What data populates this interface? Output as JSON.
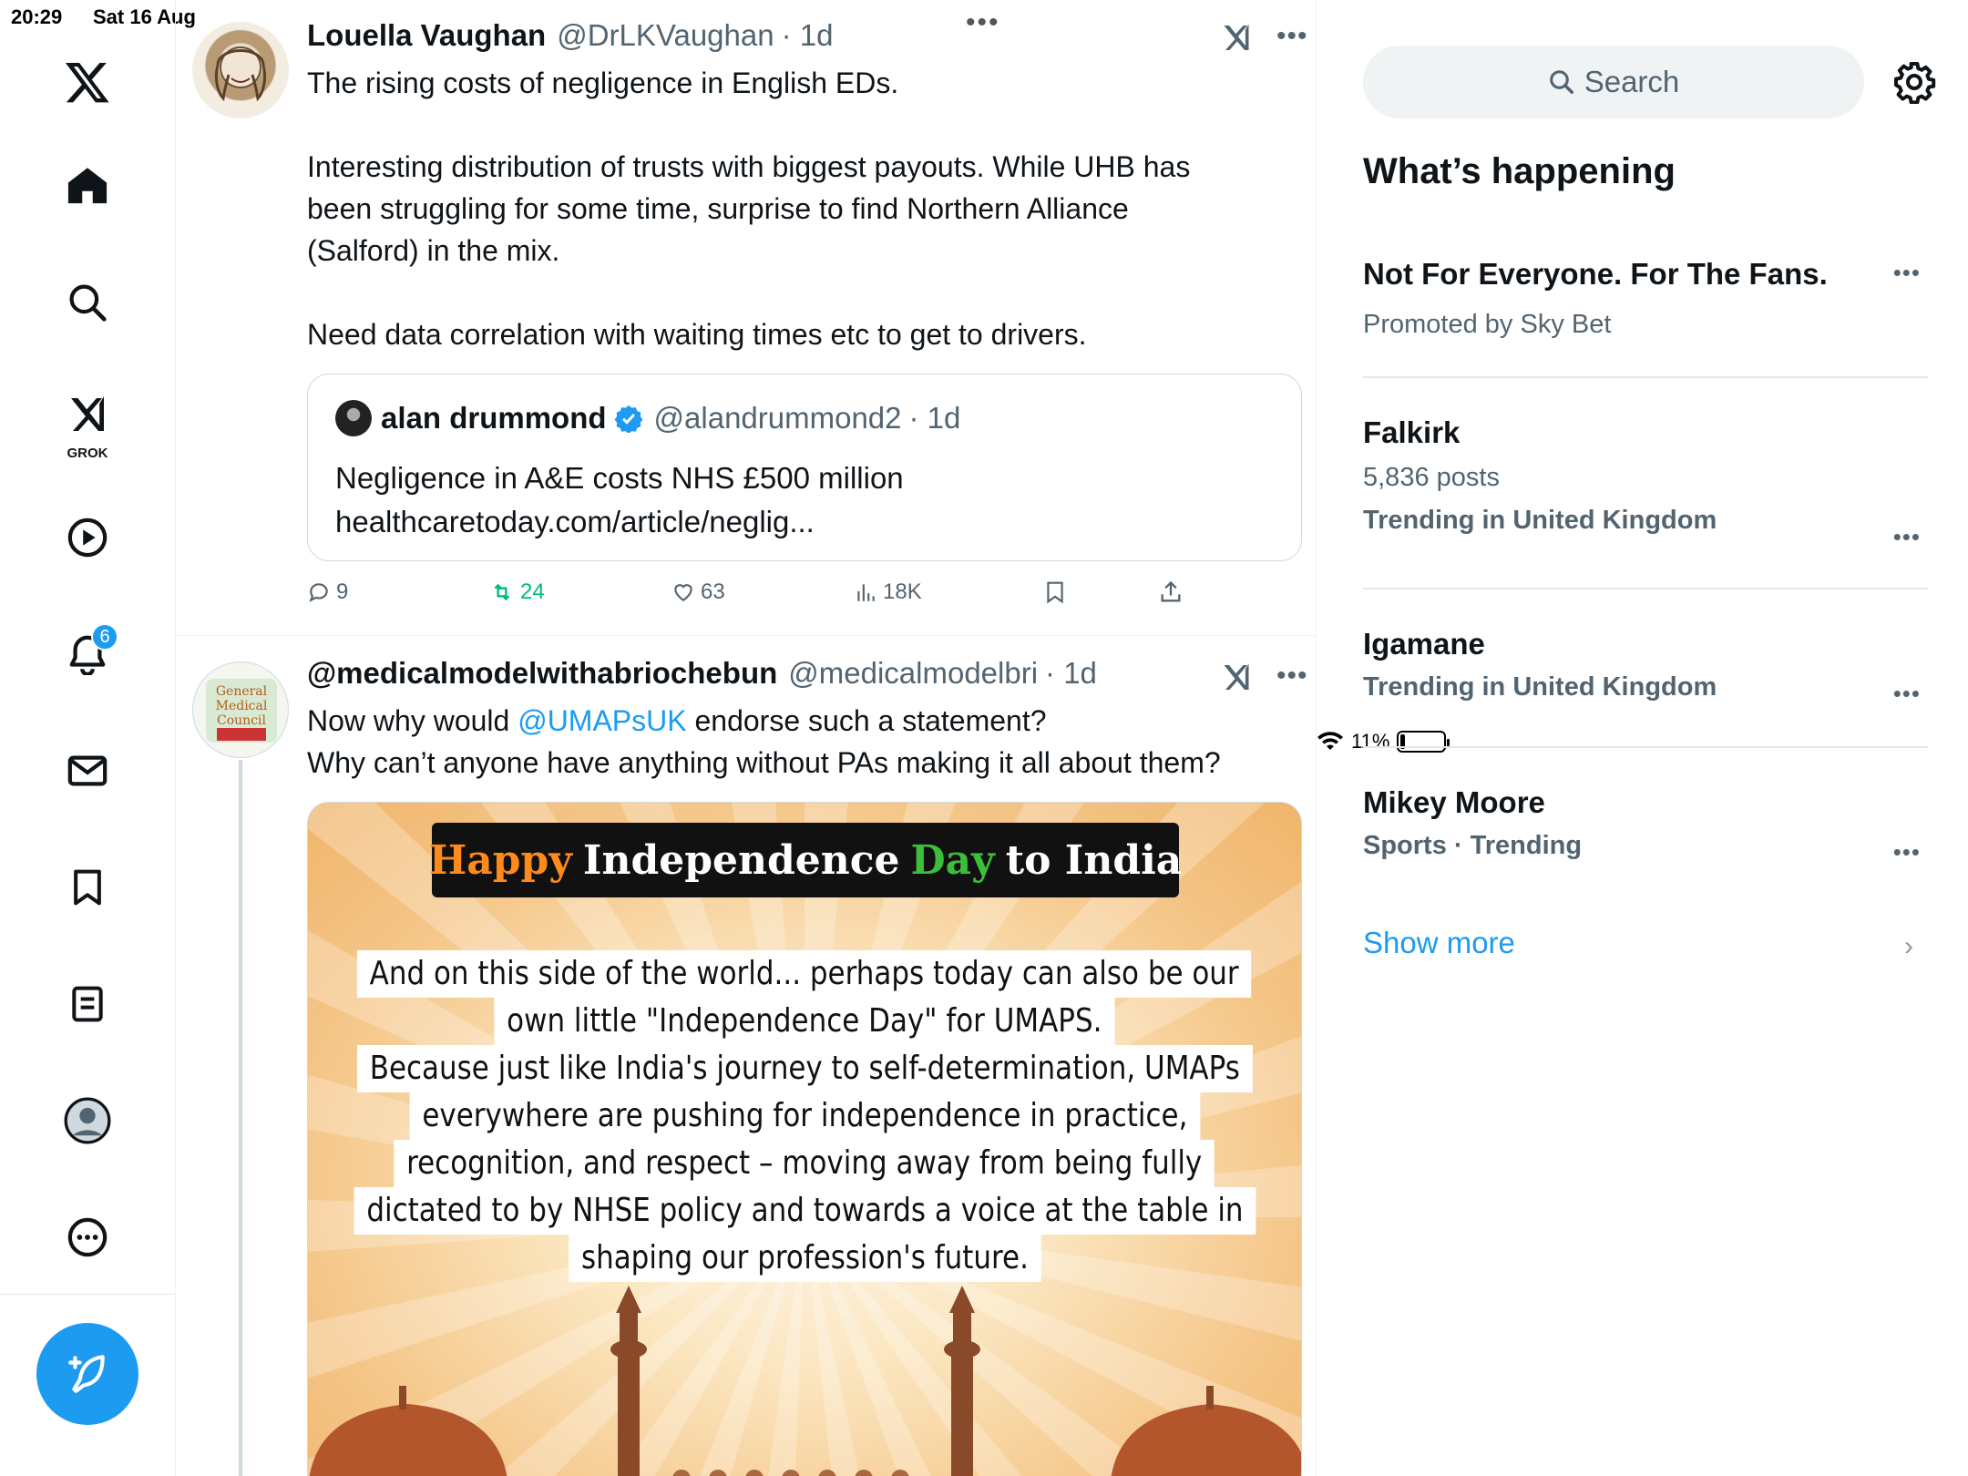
{
  "status_bar": {
    "time": "20:29",
    "date": "Sat 16 Aug",
    "battery": "11%"
  },
  "nav": {
    "notifications_badge": "6",
    "grok_label": "GROK"
  },
  "tweets": [
    {
      "name": "Louella Vaughan",
      "handle": "@DrLKVaughan",
      "time": "· 1d",
      "text": [
        "The rising costs of negligence in English EDs.",
        "",
        "Interesting distribution of trusts with biggest payouts. While UHB has",
        "been struggling for some time, surprise to find Northern Alliance",
        "(Salford) in the mix.",
        "",
        "Need data correlation with waiting times etc to get to drivers."
      ],
      "quote": {
        "name": "alan drummond",
        "handle": "@alandrummond2",
        "time": "· 1d",
        "line1": "Negligence in A&E costs NHS £500 million",
        "line2": "healthcaretoday.com/article/neglig..."
      },
      "actions": {
        "replies": "9",
        "reposts": "24",
        "likes": "63",
        "views": "18K"
      }
    },
    {
      "name": "@medicalmodelwithabriochebun",
      "handle": "@medicalmodelbri",
      "time": "· 1d",
      "text_line1_pre": "Now why would ",
      "text_mention": "@UMAPsUK",
      "text_line1_post": " endorse such a statement?",
      "text_line2": "Why can’t anyone have anything without PAs making it all about them?",
      "image": {
        "banner": [
          "Happy",
          "Independence",
          "Day",
          "to India"
        ],
        "lines": [
          "And on this side of the world... perhaps today can also be our",
          "own little \"Independence Day\" for UMAPS.",
          "Because just like India's journey to self-determination, UMAPs",
          "everywhere are pushing for independence in practice,",
          "recognition, and respect – moving away from being fully",
          "dictated to by NHSE policy and towards a voice at the table in",
          "shaping our profession's future."
        ]
      }
    }
  ],
  "sidebar": {
    "search_placeholder": "Search",
    "title": "What’s happening",
    "trends": [
      {
        "title": "Not For Everyone. For The Fans.",
        "sub": "Promoted by Sky Bet"
      },
      {
        "title": "Falkirk",
        "posts": "5,836 posts",
        "sub": "Trending in United Kingdom"
      },
      {
        "title": "Igamane",
        "sub": "Trending in United Kingdom"
      },
      {
        "title": "Mikey Moore",
        "sub": "Sports · Trending"
      }
    ],
    "show_more": "Show more"
  },
  "colors": {
    "accent": "#1d9bf0",
    "repost_green": "#00ba7c",
    "secondary_text": "#536471"
  }
}
